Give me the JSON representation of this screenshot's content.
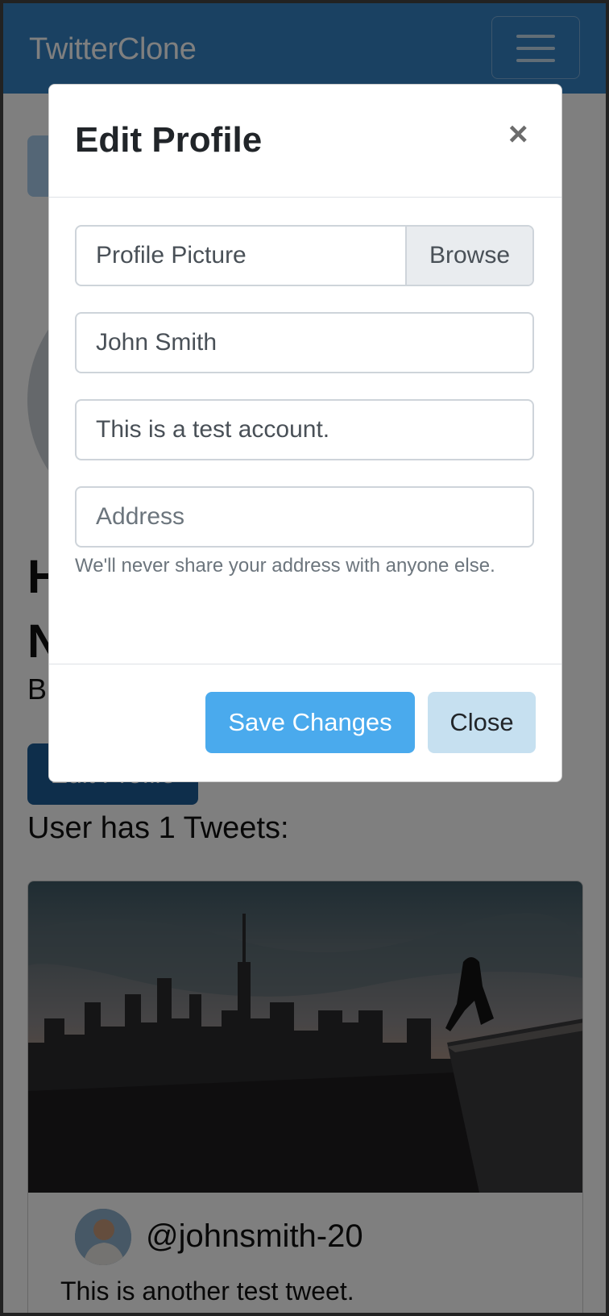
{
  "navbar": {
    "brand": "TwitterClone",
    "toggler_icon": "hamburger-icon",
    "color": "#3582c4"
  },
  "profile": {
    "name_partial": "H\nN",
    "bio_partial": "B",
    "edit_button": "Edit Profile",
    "tweets_count": "User has 1 Tweets:"
  },
  "tweet": {
    "handle": "@johnsmith-20",
    "text": "This is another test tweet."
  },
  "modal": {
    "title": "Edit Profile",
    "close_icon": "close-icon",
    "file_input": {
      "label": "Profile Picture",
      "browse": "Browse"
    },
    "name_value": "John Smith",
    "bio_value": "This is a test account.",
    "address_placeholder": "Address",
    "help_text": "We'll never share your address with anyone else.",
    "save_button": "Save Changes",
    "close_button": "Close",
    "colors": {
      "save": "#4aaaed",
      "close": "#c6e0f0"
    }
  }
}
